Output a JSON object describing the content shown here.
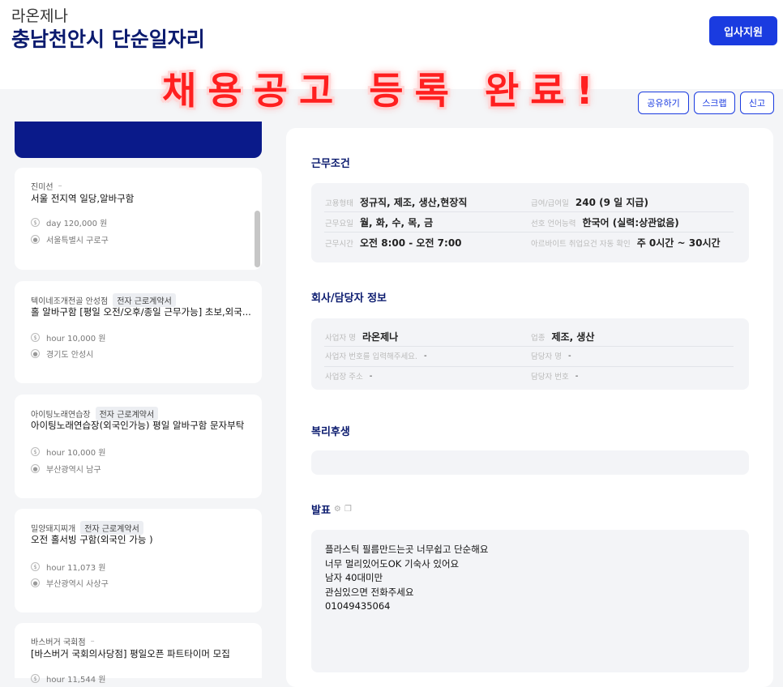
{
  "header": {
    "company": "라온제나",
    "title": "충남천안시 단순일자리",
    "apply_label": "입사지원",
    "banner": "채용공고 등록 완료!"
  },
  "actions": {
    "share": "공유하기",
    "scrap": "스크랩",
    "report": "신고"
  },
  "sidebar": {
    "cards": [
      {
        "company": "진미선",
        "tag": "",
        "title": "서울 전지역 일당,알바구함",
        "pay": "day 120,000 원",
        "location": "서울특별시 구로구"
      },
      {
        "company": "텍이네조개전골 안성점",
        "tag": "전자 근로계약서",
        "title": "홀 알바구함 [평일 오전/오후/종일 근무가능] 초보,외국...",
        "pay": "hour 10,000 원",
        "location": "경기도 안성시"
      },
      {
        "company": "아이팅노래연습장",
        "tag": "전자 근로계약서",
        "title": "아이팅노래연습장(외국인가능) 평일 알바구함 문자부탁",
        "pay": "hour 10,000 원",
        "location": "부산광역시 남구"
      },
      {
        "company": "밀양돼지찌개",
        "tag": "전자 근로계약서",
        "title": "오전 홀서빙 구함(외국인 가능 )",
        "pay": "hour 11,073 원",
        "location": "부산광역시 사상구"
      },
      {
        "company": "바스버거 국회점",
        "tag": "",
        "title": "[바스버거 국회의사당점] 평일오픈 파트타이머 모집",
        "pay": "hour 11,544 원",
        "location": ""
      }
    ]
  },
  "conditions": {
    "heading": "근무조건",
    "employment_type": {
      "label": "고용형태",
      "value": "정규직, 제조, 생산,현장직"
    },
    "pay": {
      "label": "급여/급여일",
      "value": "240 (9 일 지급)"
    },
    "days": {
      "label": "근무요일",
      "value": "월, 화, 수, 목, 금"
    },
    "language": {
      "label": "선호 언어능력",
      "value": "한국어 (실력:상관없음)"
    },
    "hours": {
      "label": "근무시간",
      "value": "오전 8:00 - 오전 7:00"
    },
    "parttime": {
      "label": "아르바이트 취업요건 자동 확인",
      "value": "주 0시간 ~ 30시간"
    }
  },
  "company_info": {
    "heading": "회사/담당자 정보",
    "name": {
      "label": "사업자 명",
      "value": "라온제나"
    },
    "industry": {
      "label": "업종",
      "value": "제조, 생산"
    },
    "biz_no": {
      "label": "사업자 번호를 입력해주세요.",
      "value": "-"
    },
    "manager": {
      "label": "담당자 명",
      "value": "-"
    },
    "address": {
      "label": "사업장 주소",
      "value": "-"
    },
    "manager_phone": {
      "label": "담당자 번호",
      "value": "-"
    }
  },
  "welfare": {
    "heading": "복리후생"
  },
  "announce": {
    "heading": "발표",
    "memo": "플라스틱 필름만드는곳 너무쉽고 단순해요\n너무 멀리있어도OK 기숙사 있어요\n남자 40대미만\n관심있으면 전화주세요\n01049435064"
  }
}
